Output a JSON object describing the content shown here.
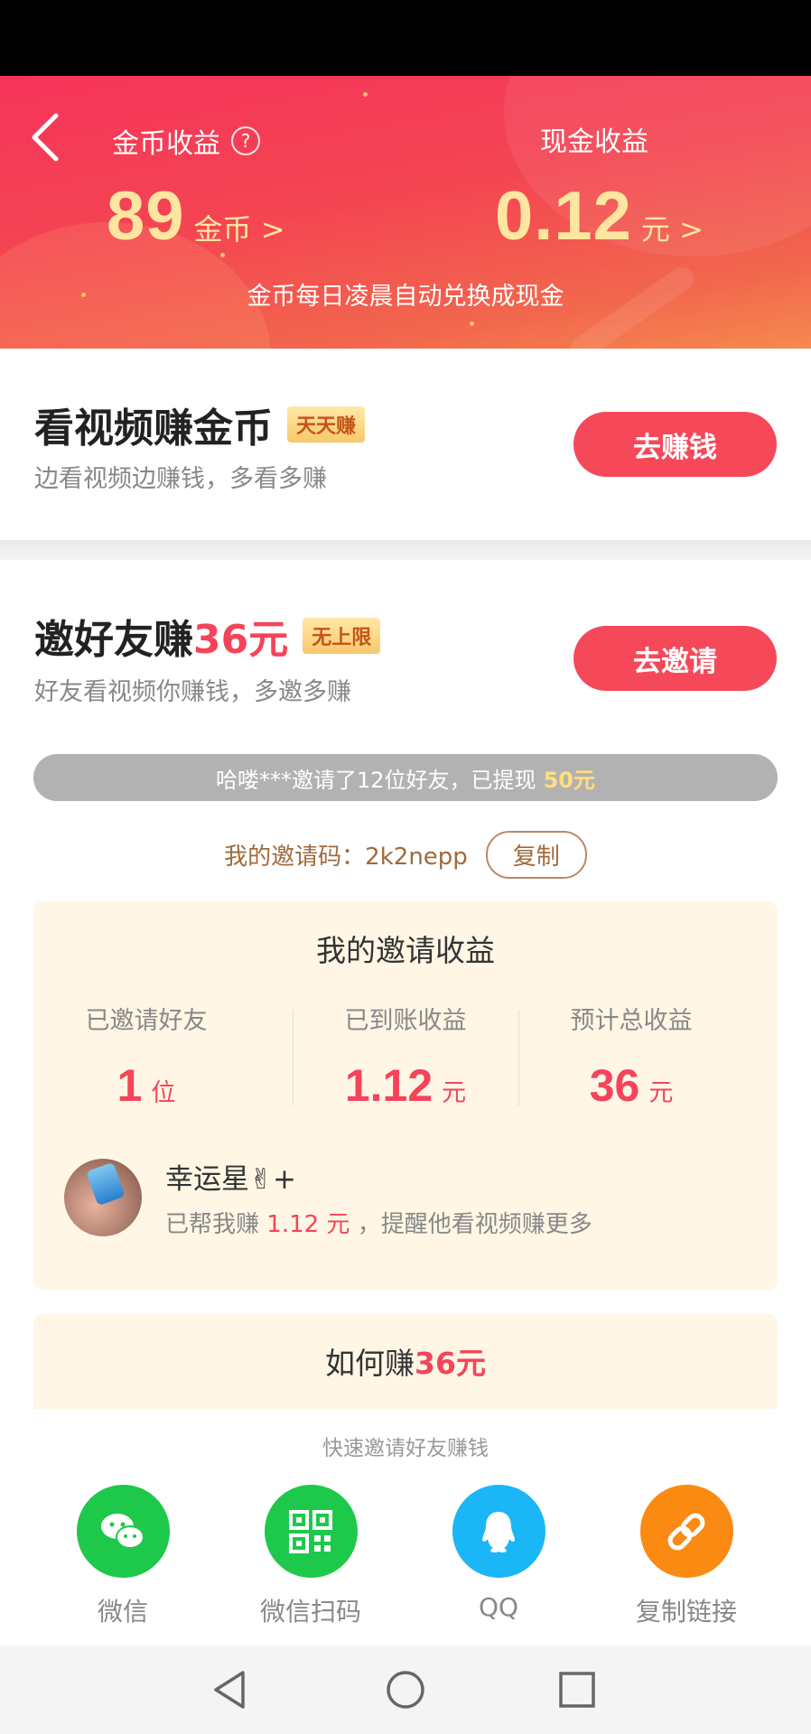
{
  "header": {
    "coin_title": "金币收益",
    "help": "?",
    "coin_value": "89",
    "coin_unit": "金币 >",
    "cash_title": "现金收益",
    "cash_value": "0.12",
    "cash_unit": "元 >",
    "note": "金币每日凌晨自动兑换成现金"
  },
  "watch_task": {
    "title": "看视频赚金币",
    "tag": "天天赚",
    "subtitle": "边看视频边赚钱，多看多赚",
    "button": "去赚钱"
  },
  "invite_task": {
    "title_prefix": "邀好友赚",
    "title_amount": "36元",
    "tag": "无上限",
    "subtitle": "好友看视频你赚钱，多邀多赚",
    "button": "去邀请"
  },
  "ticker": {
    "text": "哈喽***邀请了12位好友，已提现",
    "amount": "50元"
  },
  "invite_code": {
    "label": "我的邀请码：2k2nepp",
    "copy": "复制"
  },
  "earnings": {
    "title": "我的邀请收益",
    "stats": [
      {
        "label": "已邀请好友",
        "value": "1",
        "unit": "位"
      },
      {
        "label": "已到账收益",
        "value": "1.12",
        "unit": "元"
      },
      {
        "label": "预计总收益",
        "value": "36",
        "unit": "元"
      }
    ],
    "friend": {
      "name": "幸运星✌+",
      "desc_prefix": "已帮我赚",
      "amount": "1.12 元",
      "desc_suffix": "，提醒他看视频赚更多"
    }
  },
  "how": {
    "prefix": "如何赚",
    "amount": "36元"
  },
  "share": {
    "title": "快速邀请好友赚钱",
    "items": [
      {
        "label": "微信",
        "icon": "wechat-icon",
        "color": "#1ec84a"
      },
      {
        "label": "微信扫码",
        "icon": "qr-code-icon",
        "color": "#1ec84a"
      },
      {
        "label": "QQ",
        "icon": "qq-icon",
        "color": "#1ab6f5"
      },
      {
        "label": "复制链接",
        "icon": "link-icon",
        "color": "#fb8a12"
      }
    ]
  },
  "colors": {
    "accent": "#f5495a",
    "gold": "#ffe6a0",
    "panel": "#fff6e5"
  }
}
